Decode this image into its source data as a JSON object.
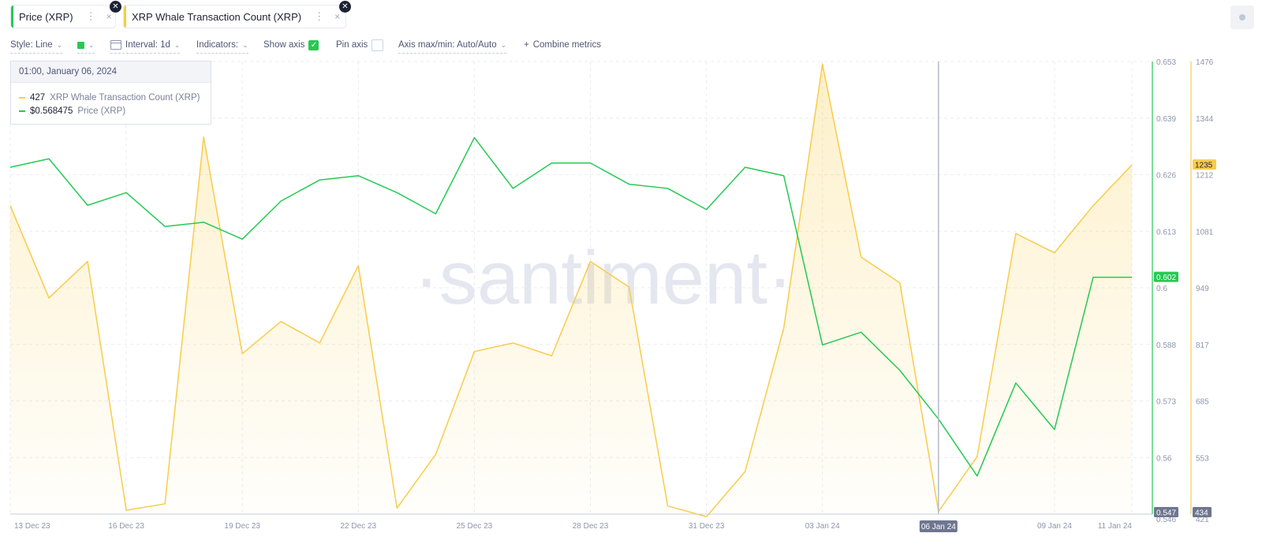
{
  "tabs": [
    {
      "label": "Price (XRP)",
      "color": "#26c953",
      "close": "×",
      "dots": "⋮",
      "badge": "✕"
    },
    {
      "label": "XRP Whale Transaction Count (XRP)",
      "color": "#f8cc4a",
      "close": "×",
      "dots": "⋮",
      "badge": "✕"
    }
  ],
  "toolbar": {
    "style": "Style: Line",
    "interval": "Interval: 1d",
    "indicators": "Indicators:",
    "show_axis": "Show axis",
    "pin_axis": "Pin axis",
    "axis_maxmin": "Axis max/min: Auto/Auto",
    "combine": "Combine metrics",
    "plus": "+",
    "checkmark": "✓"
  },
  "tooltip": {
    "date": "01:00, January 06, 2024",
    "rows": [
      {
        "value": "427",
        "name": "XRP Whale Transaction Count (XRP)",
        "color": "#f8cc4a"
      },
      {
        "value": "$0.568475",
        "name": "Price (XRP)",
        "color": "#26c953"
      }
    ]
  },
  "watermark": "·santiment·",
  "colors": {
    "price": "#26c953",
    "whale": "#f8cc4a",
    "axis_text": "#8e96ad",
    "grid": "#e9ecf2"
  },
  "chart_data": {
    "type": "line",
    "x": [
      "13 Dec 23",
      "14 Dec 23",
      "15 Dec 23",
      "16 Dec 23",
      "17 Dec 23",
      "18 Dec 23",
      "19 Dec 23",
      "20 Dec 23",
      "21 Dec 23",
      "22 Dec 23",
      "23 Dec 23",
      "24 Dec 23",
      "25 Dec 23",
      "26 Dec 23",
      "27 Dec 23",
      "28 Dec 23",
      "29 Dec 23",
      "30 Dec 23",
      "31 Dec 23",
      "01 Jan 24",
      "02 Jan 24",
      "03 Jan 24",
      "04 Jan 24",
      "05 Jan 24",
      "06 Jan 24",
      "07 Jan 24",
      "08 Jan 24",
      "09 Jan 24",
      "10 Jan 24",
      "11 Jan 24"
    ],
    "x_ticks": [
      "13 Dec 23",
      "16 Dec 23",
      "19 Dec 23",
      "22 Dec 23",
      "25 Dec 23",
      "28 Dec 23",
      "31 Dec 23",
      "03 Jan 24",
      "06 Jan 24",
      "09 Jan 24",
      "11 Jan 24"
    ],
    "highlighted_x": "06 Jan 24",
    "series": [
      {
        "name": "Price (XRP)",
        "axis": "left",
        "color": "#26c953",
        "values": [
          0.628,
          0.63,
          0.619,
          0.622,
          0.614,
          0.615,
          0.611,
          0.62,
          0.625,
          0.626,
          0.622,
          0.617,
          0.635,
          0.623,
          0.629,
          0.629,
          0.624,
          0.623,
          0.618,
          0.628,
          0.626,
          0.586,
          0.589,
          0.58,
          0.568475,
          0.555,
          0.577,
          0.566,
          0.602,
          0.602
        ],
        "last_label": "0.602"
      },
      {
        "name": "XRP Whale Transaction Count (XRP)",
        "axis": "right",
        "color": "#f8cc4a",
        "values": [
          1140,
          925,
          1010,
          430,
          445,
          1300,
          795,
          870,
          820,
          1000,
          435,
          560,
          800,
          820,
          790,
          1010,
          950,
          440,
          415,
          520,
          855,
          1470,
          1020,
          960,
          427,
          555,
          1075,
          1030,
          1140,
          1235
        ],
        "last_label": "1235"
      }
    ],
    "y_left": {
      "ticks": [
        "0.653",
        "0.639",
        "0.626",
        "0.613",
        "0.6",
        "0.588",
        "0.573",
        "0.56",
        "0.547"
      ],
      "min": 0.546,
      "max": 0.653,
      "min_label": "0.547",
      "cut_label": "0.546"
    },
    "y_right": {
      "ticks": [
        "1476",
        "1344",
        "1212",
        "1081",
        "949",
        "817",
        "685",
        "553",
        "421"
      ],
      "min": 421,
      "max": 1476,
      "min_label": "434",
      "cut_label": "421"
    }
  }
}
